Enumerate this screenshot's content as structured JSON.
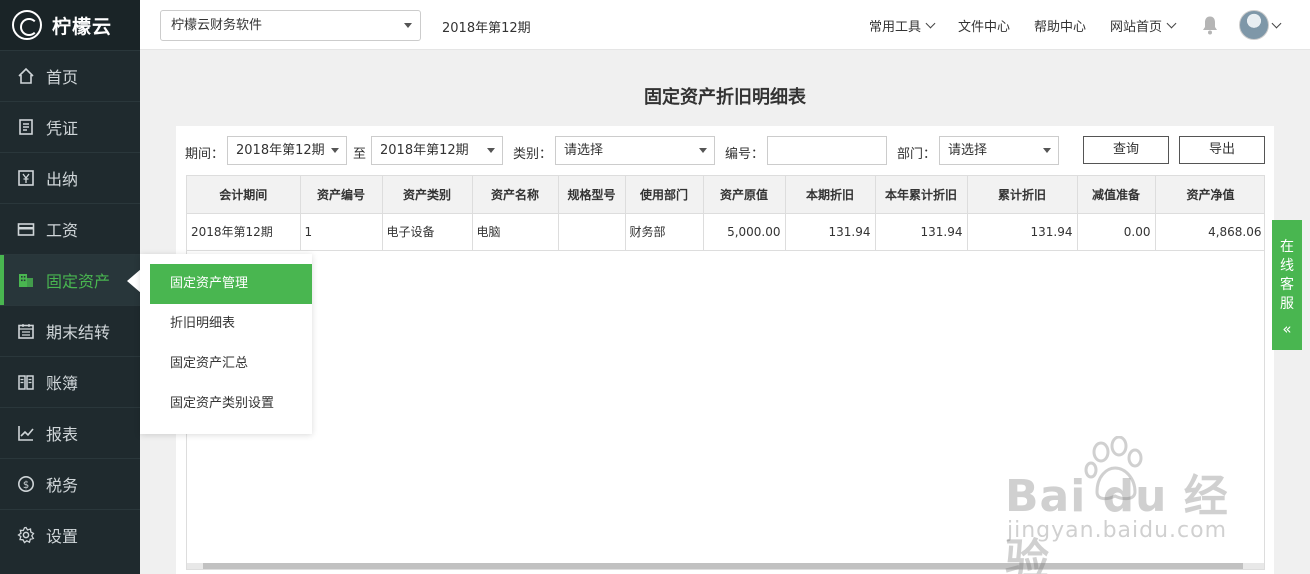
{
  "brand": {
    "name": "柠檬云"
  },
  "sidebar": {
    "items": [
      {
        "label": "首页",
        "icon": "home-icon"
      },
      {
        "label": "凭证",
        "icon": "document-icon"
      },
      {
        "label": "出纳",
        "icon": "yen-icon"
      },
      {
        "label": "工资",
        "icon": "card-icon"
      },
      {
        "label": "固定资产",
        "icon": "building-icon",
        "active": true
      },
      {
        "label": "期末结转",
        "icon": "calendar-icon"
      },
      {
        "label": "账簿",
        "icon": "book-icon"
      },
      {
        "label": "报表",
        "icon": "chart-icon"
      },
      {
        "label": "税务",
        "icon": "dollar-icon"
      },
      {
        "label": "设置",
        "icon": "gear-icon"
      }
    ]
  },
  "topbar": {
    "account_select": "柠檬云财务软件",
    "period": "2018年第12期",
    "links": {
      "tools": "常用工具",
      "files": "文件中心",
      "help": "帮助中心",
      "site": "网站首页"
    }
  },
  "submenu": {
    "items": [
      "固定资产管理",
      "折旧明细表",
      "固定资产汇总",
      "固定资产类别设置"
    ]
  },
  "page": {
    "title": "固定资产折旧明细表"
  },
  "filters": {
    "period_label": "期间：",
    "period_from": "2018年第12期",
    "to_label": "至",
    "period_to": "2018年第12期",
    "category_label": "类别：",
    "category_value": "请选择",
    "number_label": "编号：",
    "number_value": "",
    "dept_label": "部门：",
    "dept_value": "请选择",
    "query_button": "查询",
    "export_button": "导出"
  },
  "table": {
    "columns": [
      "会计期间",
      "资产编号",
      "资产类别",
      "资产名称",
      "规格型号",
      "使用部门",
      "资产原值",
      "本期折旧",
      "本年累计折旧",
      "累计折旧",
      "减值准备",
      "资产净值"
    ],
    "rows": [
      [
        "2018年第12期",
        "1",
        "电子设备",
        "电脑",
        "",
        "财务部",
        "5,000.00",
        "131.94",
        "131.94",
        "131.94",
        "0.00",
        "4,868.06"
      ]
    ]
  },
  "service": {
    "label": "在线客服",
    "arrow": "«"
  },
  "watermark": {
    "main": "Bai du 经验",
    "sub": "jingyan.baidu.com"
  },
  "colors": {
    "accent": "#49b650",
    "sidebar_bg": "#1f2a2e"
  }
}
